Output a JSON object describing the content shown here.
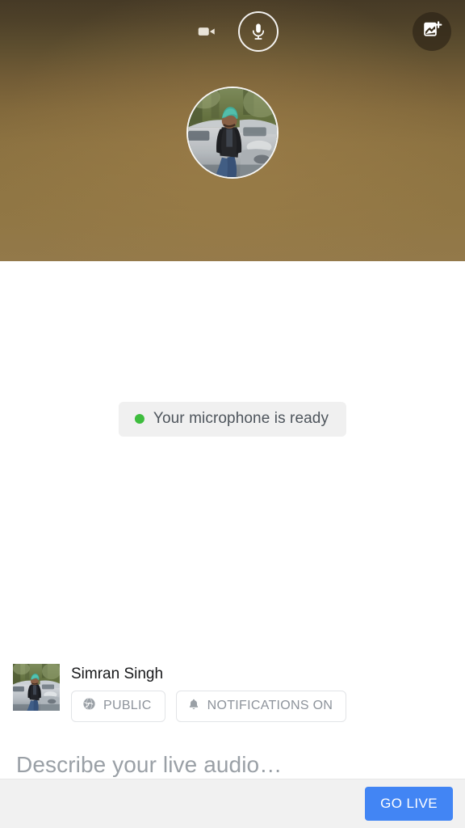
{
  "hero": {
    "mode_controls": [
      {
        "name": "video-mode",
        "icon": "video-camera-icon",
        "active": false
      },
      {
        "name": "audio-mode",
        "icon": "microphone-icon",
        "active": true
      }
    ],
    "media_button": {
      "icon": "add-image-icon",
      "label": ""
    },
    "avatar": {
      "alt": "Profile photo of Simran Singh sitting on a car"
    },
    "background_colors": {
      "top": "#463a26",
      "bottom": "#93794a"
    }
  },
  "stage": {
    "status": {
      "text": "Your microphone is ready",
      "dot_color": "#3ebd3e",
      "background": "#f0f0f0"
    }
  },
  "composer": {
    "author_name": "Simran Singh",
    "thumbnail_alt": "Simran Singh profile thumbnail",
    "chips": [
      {
        "icon": "globe-icon",
        "label": "PUBLIC"
      },
      {
        "icon": "bell-icon",
        "label": "NOTIFICATIONS ON"
      }
    ],
    "description_placeholder": "Describe your live audio…"
  },
  "bottom_bar": {
    "go_live_label": "GO LIVE",
    "accent_color": "#4285f4",
    "background": "#f1f1f1"
  }
}
